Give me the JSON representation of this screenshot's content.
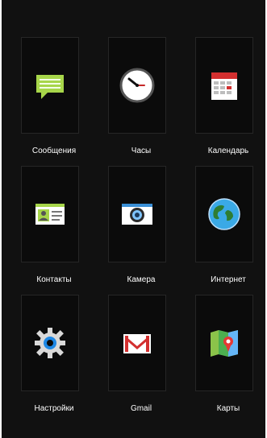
{
  "apps": [
    {
      "label": "Сообщения",
      "icon": "messages-icon"
    },
    {
      "label": "Часы",
      "icon": "clock-icon"
    },
    {
      "label": "Календарь",
      "icon": "calendar-icon"
    },
    {
      "label": "Контакты",
      "icon": "contacts-icon"
    },
    {
      "label": "Камера",
      "icon": "camera-icon"
    },
    {
      "label": "Интернет",
      "icon": "globe-icon"
    },
    {
      "label": "Настройки",
      "icon": "settings-gear-icon"
    },
    {
      "label": "Gmail",
      "icon": "gmail-icon"
    },
    {
      "label": "Карты",
      "icon": "maps-icon"
    }
  ],
  "colors": {
    "background": "#111111",
    "tile": "#0b0b0b",
    "label_text": "#ffffff"
  }
}
